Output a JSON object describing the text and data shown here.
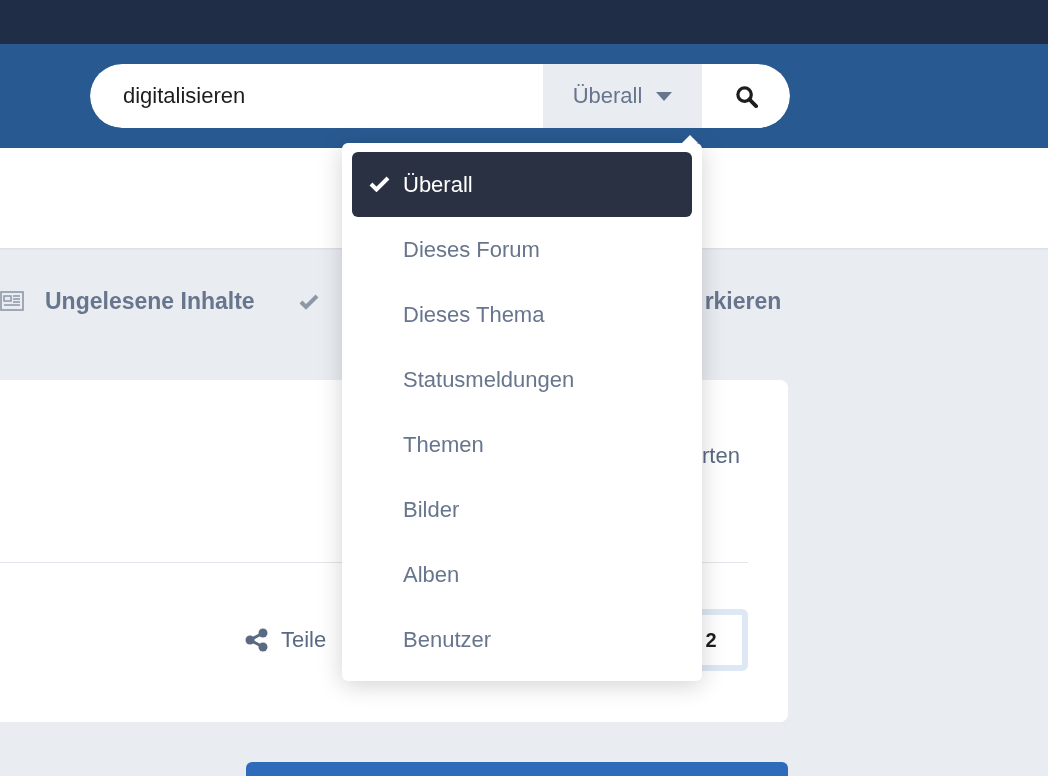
{
  "search": {
    "value": "digitalisieren",
    "scope": "Überall"
  },
  "scope_menu": {
    "items": [
      {
        "label": "Überall",
        "selected": true
      },
      {
        "label": "Dieses Forum",
        "selected": false
      },
      {
        "label": "Dieses Thema",
        "selected": false
      },
      {
        "label": "Statusmeldungen",
        "selected": false
      },
      {
        "label": "Themen",
        "selected": false
      },
      {
        "label": "Bilder",
        "selected": false
      },
      {
        "label": "Alben",
        "selected": false
      },
      {
        "label": "Benutzer",
        "selected": false
      }
    ]
  },
  "nav": {
    "items": [
      {
        "label": "Ungelesene Inhalte"
      },
      {
        "label": "rkieren"
      }
    ]
  },
  "card": {
    "text": "rten",
    "share": "Teile",
    "count": "2"
  }
}
